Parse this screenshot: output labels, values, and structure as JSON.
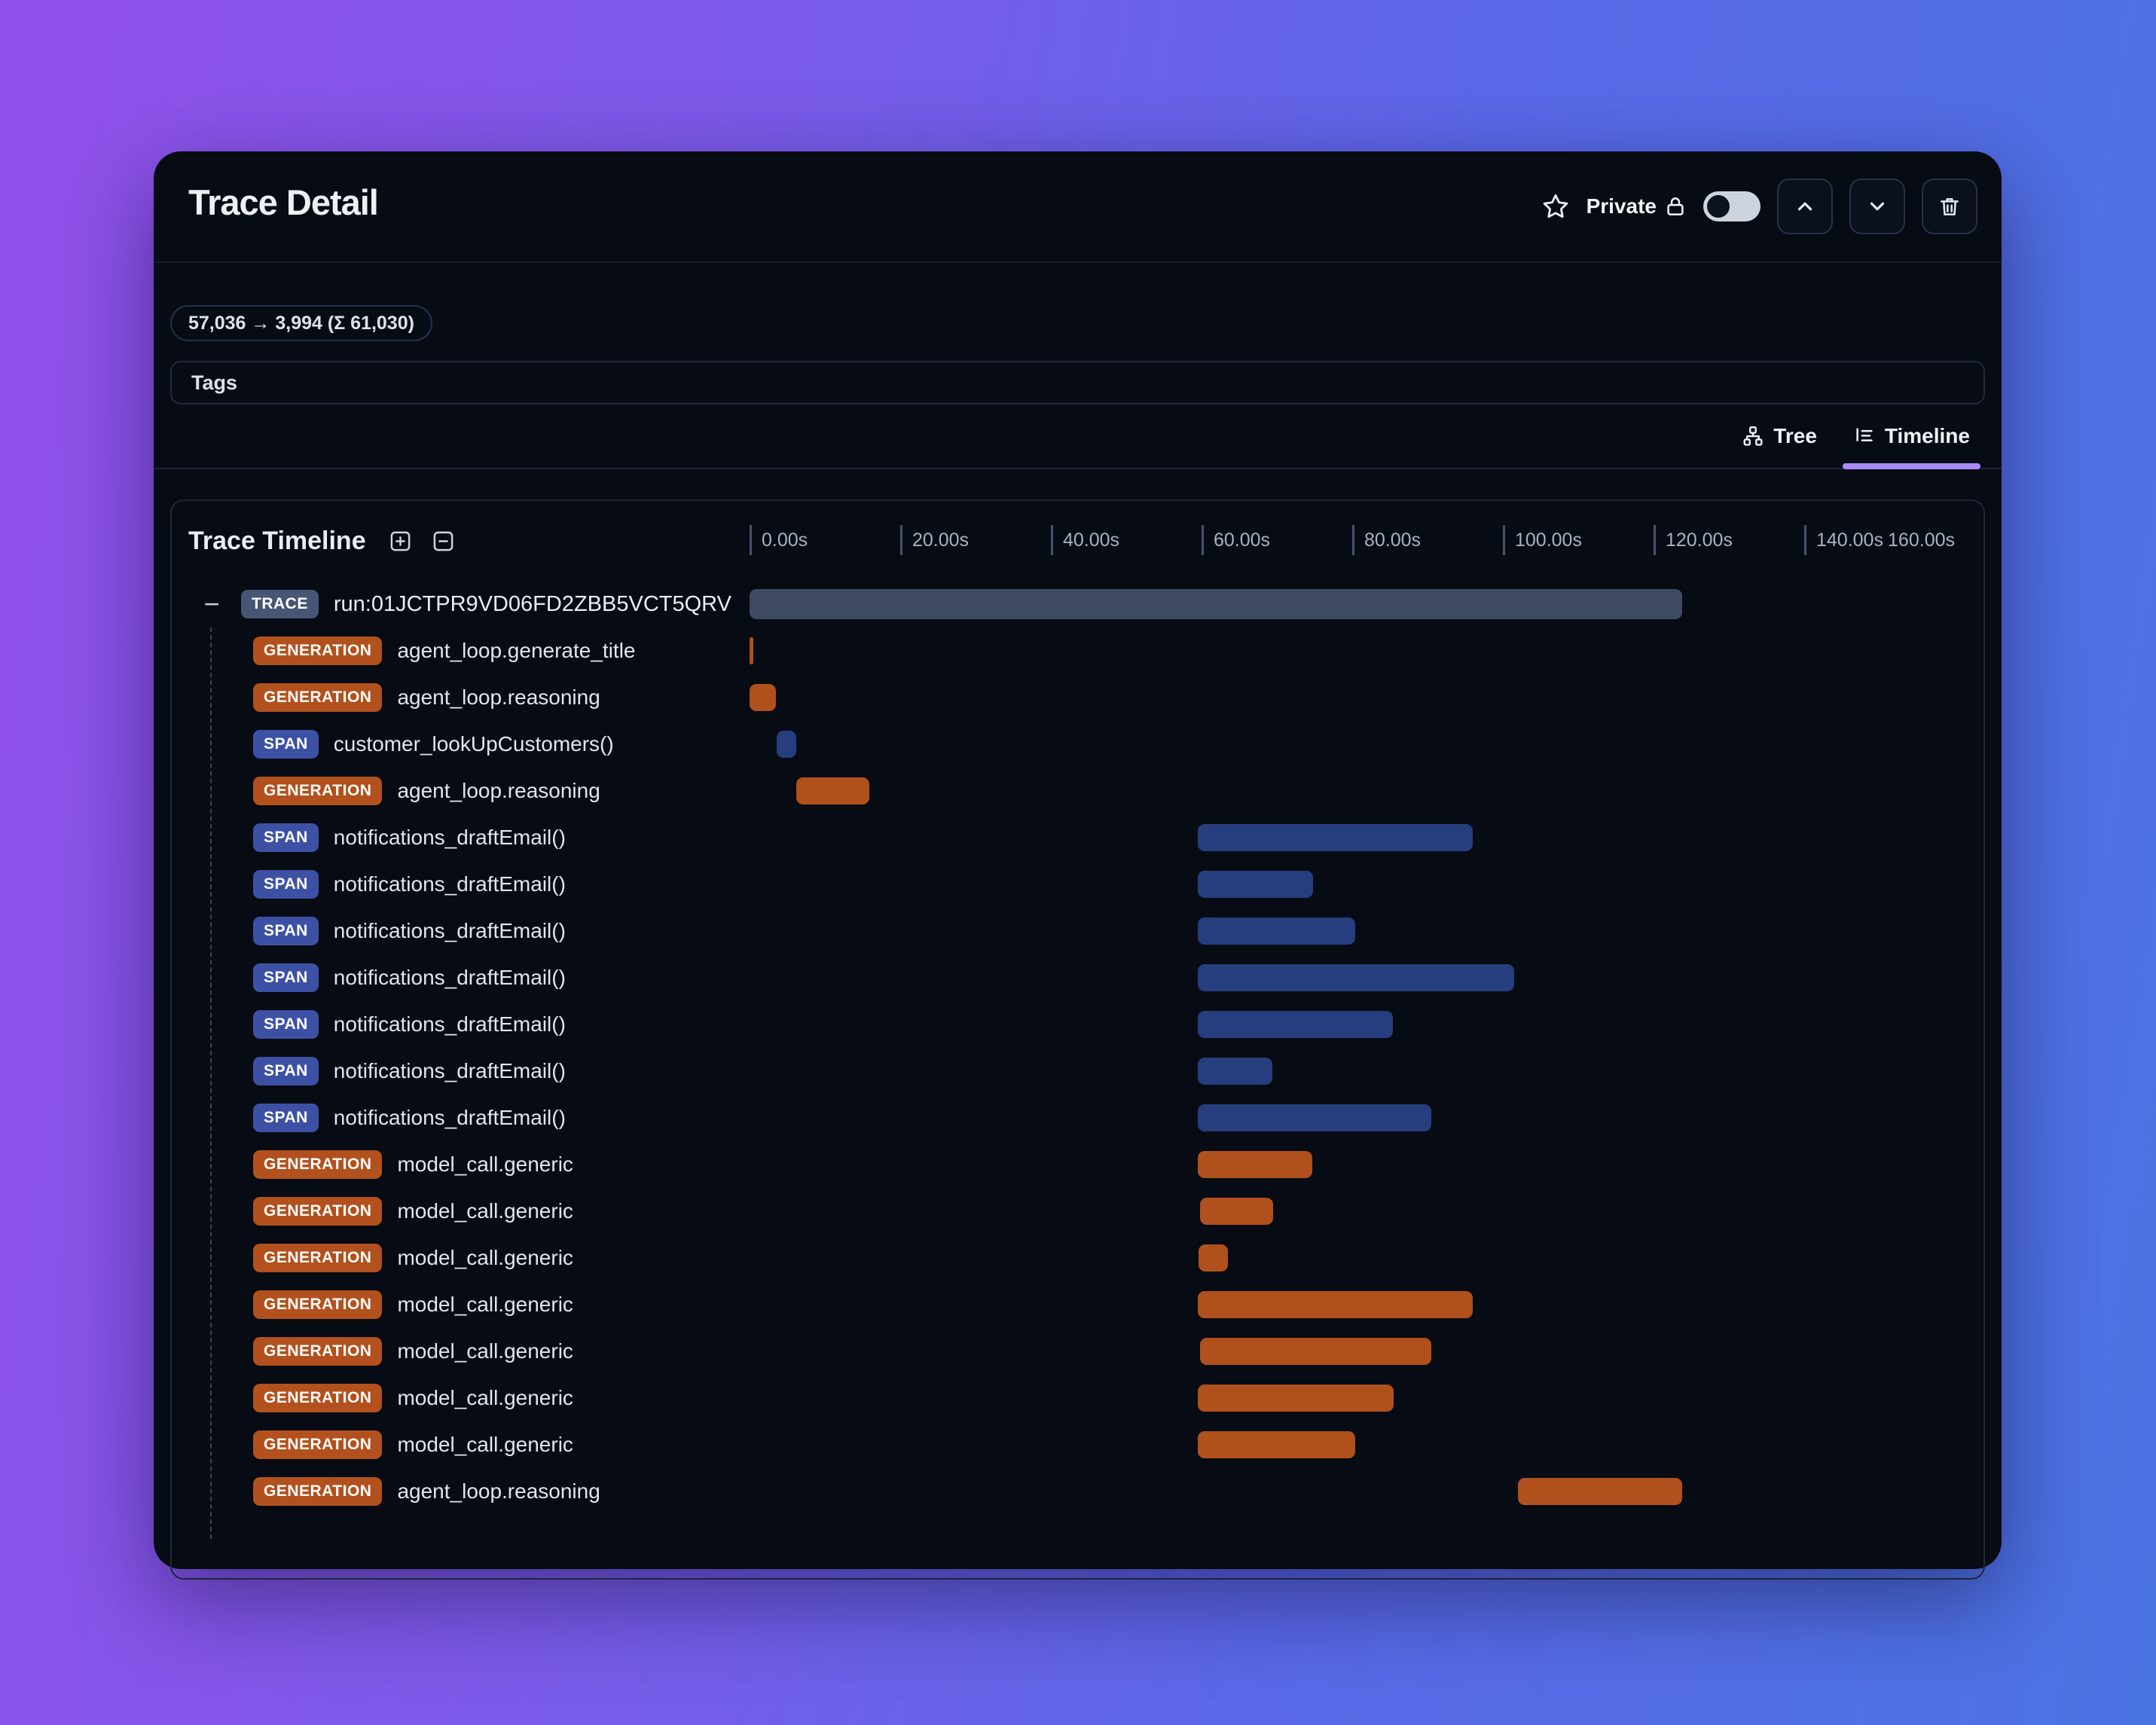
{
  "window": {
    "title": "Trace Detail",
    "header_controls": {
      "star_icon": "star-outline",
      "privacy_label": "Private",
      "lock_icon": "lock",
      "visibility_toggle_state": "off",
      "nav_up_icon": "chevron-up",
      "nav_down_icon": "chevron-down",
      "delete_icon": "trash"
    },
    "token_usage_badge": "57,036 → 3,994 (Σ 61,030)",
    "tags_label": "Tags",
    "view_tabs": [
      {
        "label": "Tree",
        "icon": "tree-icon",
        "active": false
      },
      {
        "label": "Timeline",
        "icon": "timeline-icon",
        "active": true
      }
    ]
  },
  "timeline_panel": {
    "title": "Trace Timeline",
    "expand_all_icon": "plus-square",
    "collapse_all_icon": "minus-square",
    "axis": {
      "min_s": 0,
      "max_s": 160,
      "step_s": 20,
      "tick_labels": [
        "0.00s",
        "20.00s",
        "40.00s",
        "60.00s",
        "80.00s",
        "100.00s",
        "120.00s",
        "140.00s",
        "160.00s"
      ]
    },
    "rows": [
      {
        "type": "TRACE",
        "label": "run:01JCTPR9VD06FD2ZBB5VCT5QRV",
        "start_s": 0,
        "end_s": 123.8,
        "collapse_toggle": "−"
      },
      {
        "type": "GENERATION",
        "label": "agent_loop.generate_title",
        "start_s": 0,
        "end_s": 0.5
      },
      {
        "type": "GENERATION",
        "label": "agent_loop.reasoning",
        "start_s": 0,
        "end_s": 3.5
      },
      {
        "type": "SPAN",
        "label": "customer_lookUpCustomers()",
        "start_s": 3.6,
        "end_s": 6.2
      },
      {
        "type": "GENERATION",
        "label": "agent_loop.reasoning",
        "start_s": 6.2,
        "end_s": 15.9
      },
      {
        "type": "SPAN",
        "label": "notifications_draftEmail()",
        "start_s": 59.5,
        "end_s": 96.0
      },
      {
        "type": "SPAN",
        "label": "notifications_draftEmail()",
        "start_s": 59.5,
        "end_s": 74.8
      },
      {
        "type": "SPAN",
        "label": "notifications_draftEmail()",
        "start_s": 59.5,
        "end_s": 80.4
      },
      {
        "type": "SPAN",
        "label": "notifications_draftEmail()",
        "start_s": 59.5,
        "end_s": 101.5
      },
      {
        "type": "SPAN",
        "label": "notifications_draftEmail()",
        "start_s": 59.5,
        "end_s": 85.4
      },
      {
        "type": "SPAN",
        "label": "notifications_draftEmail()",
        "start_s": 59.5,
        "end_s": 69.4
      },
      {
        "type": "SPAN",
        "label": "notifications_draftEmail()",
        "start_s": 59.5,
        "end_s": 90.5
      },
      {
        "type": "GENERATION",
        "label": "model_call.generic",
        "start_s": 59.5,
        "end_s": 74.7
      },
      {
        "type": "GENERATION",
        "label": "model_call.generic",
        "start_s": 59.8,
        "end_s": 69.5
      },
      {
        "type": "GENERATION",
        "label": "model_call.generic",
        "start_s": 59.6,
        "end_s": 63.5
      },
      {
        "type": "GENERATION",
        "label": "model_call.generic",
        "start_s": 59.5,
        "end_s": 96.0
      },
      {
        "type": "GENERATION",
        "label": "model_call.generic",
        "start_s": 59.8,
        "end_s": 90.5
      },
      {
        "type": "GENERATION",
        "label": "model_call.generic",
        "start_s": 59.5,
        "end_s": 85.5
      },
      {
        "type": "GENERATION",
        "label": "model_call.generic",
        "start_s": 59.5,
        "end_s": 80.4
      },
      {
        "type": "GENERATION",
        "label": "agent_loop.reasoning",
        "start_s": 102.0,
        "end_s": 123.8
      }
    ]
  },
  "colors": {
    "background_gradient_left": "#9150ea",
    "background_gradient_right": "#4a73e2",
    "window_bg": "#070b14",
    "card_border": "#1e2839",
    "trace_badge": "#475674",
    "trace_bar": "#3d4a61",
    "generation_color": "#b0501c",
    "span_badge": "#3d51a4",
    "span_bar": "#263e7e",
    "active_tab_underline": "#a78bfa",
    "axis_label": "#a9b2c2"
  }
}
